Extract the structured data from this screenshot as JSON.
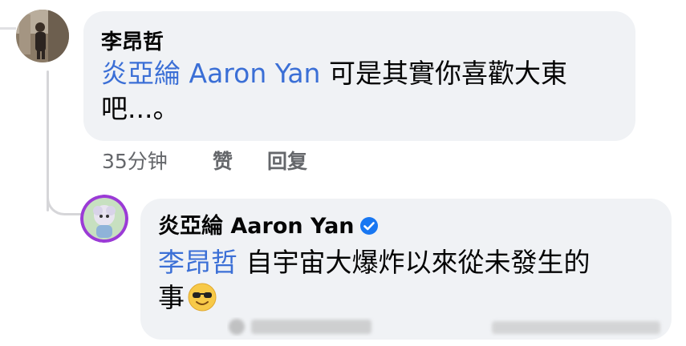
{
  "comment1": {
    "author": "李昂哲",
    "mention": "炎亞綸 Aaron Yan",
    "text_line1": " 可是其實你喜歡大東",
    "text_line2": "吧...。"
  },
  "meta": {
    "time": "35分钟",
    "like": "赞",
    "reply": "回复"
  },
  "comment2": {
    "author": "炎亞綸 Aaron Yan",
    "mention": "李昂哲",
    "text_line1": " 自宇宙大爆炸以來從未發生的",
    "text_line2": "事"
  },
  "icons": {
    "verified": "verified-badge-icon",
    "emoji": "sunglasses-emoji-icon"
  },
  "colors": {
    "mention": "#3b6fd6",
    "bubble": "#f0f2f5",
    "meta_text": "#65676b",
    "verified": "#1877f2"
  }
}
